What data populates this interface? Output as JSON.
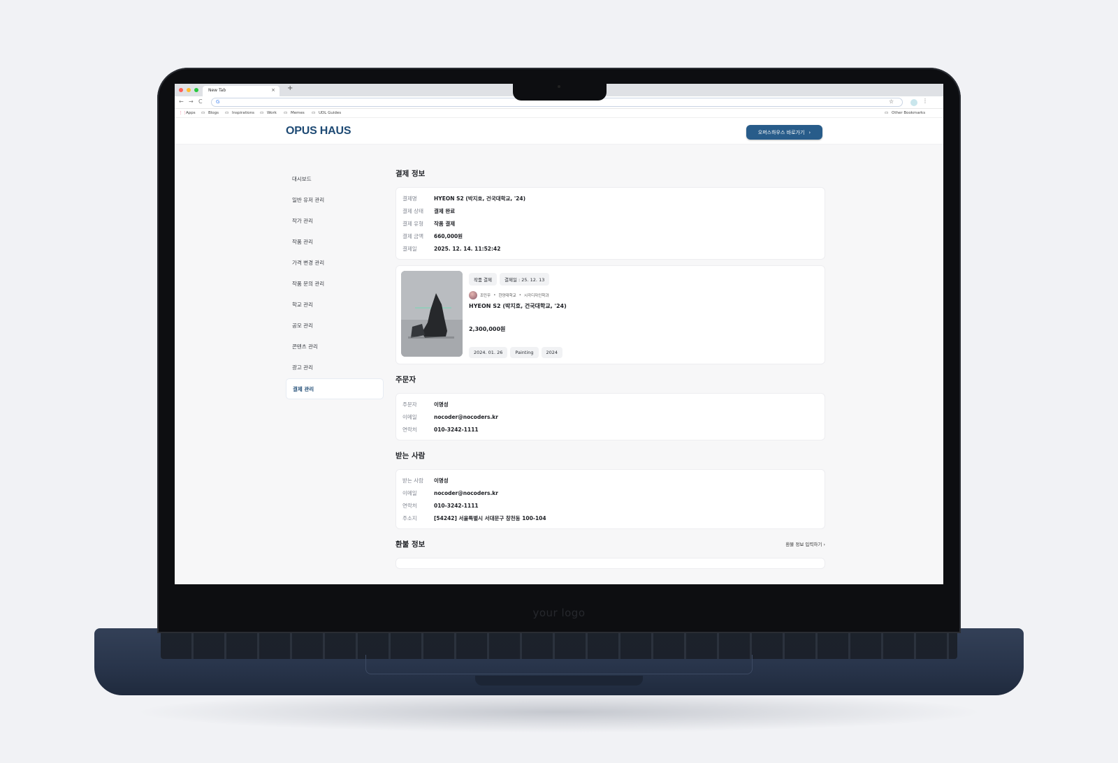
{
  "browser": {
    "tab_title": "New Tab",
    "tab_close": "×",
    "new_tab": "+",
    "address": "G",
    "nav": {
      "back": "←",
      "forward": "→",
      "reload": "C"
    },
    "star": "☆",
    "menu": "⋮",
    "bookmarks": [
      "Apps",
      "Blogs",
      "Inspirations",
      "Work",
      "Memes",
      "UDL Guides"
    ],
    "other_bookmarks": "Other Bookmarks"
  },
  "laptop": {
    "bezel_logo": "your logo"
  },
  "app": {
    "logo": "OPUS HAUS",
    "header_button": "오퍼스하우스 바로가기",
    "header_button_chevron": "›",
    "accent_color": "#285c8a"
  },
  "sidebar": {
    "items": [
      "대시보드",
      "일반 유저 관리",
      "작가 관리",
      "작품 관리",
      "가격 변경 관리",
      "작품 문의 관리",
      "학교 관리",
      "공모 관리",
      "콘텐츠 관리",
      "광고 관리",
      "결제 관리"
    ],
    "active": "결제 관리"
  },
  "payment": {
    "title": "결제 정보",
    "rows": [
      {
        "label": "결제명",
        "value": "HYEON S2 (박지호, 건국대학교, '24)"
      },
      {
        "label": "결제 상태",
        "value": "결제 완료"
      },
      {
        "label": "결제 유형",
        "value": "작품 결제"
      },
      {
        "label": "결제 금액",
        "value": "660,000원"
      },
      {
        "label": "결제일",
        "value": "2025. 12. 14. 11:52:42"
      }
    ]
  },
  "product": {
    "chips": [
      "작품 결제",
      "결제일 : 25. 12. 13"
    ],
    "artist": "조민우",
    "school": "한양대학교",
    "department": "시각디자인학과",
    "separator": "•",
    "title": "HYEON S2 (박지호, 건국대학교, '24)",
    "price": "2,300,000원",
    "tags": [
      "2024. 01. 26",
      "Painting",
      "2024"
    ]
  },
  "orderer": {
    "title": "주문자",
    "rows": [
      {
        "label": "주문자",
        "value": "이명성"
      },
      {
        "label": "이메일",
        "value": "nocoder@nocoders.kr"
      },
      {
        "label": "연락처",
        "value": "010-3242-1111"
      }
    ]
  },
  "recipient": {
    "title": "받는 사람",
    "rows": [
      {
        "label": "받는 사람",
        "value": "이명성"
      },
      {
        "label": "이메일",
        "value": "nocoder@nocoders.kr"
      },
      {
        "label": "연락처",
        "value": "010-3242-1111"
      },
      {
        "label": "주소지",
        "value": "[54242] 서울특별시 서대문구 창천동 100-104"
      }
    ]
  },
  "refund": {
    "title": "환불 정보",
    "link": "환불 정보 입력하기",
    "link_chevron": "›"
  }
}
